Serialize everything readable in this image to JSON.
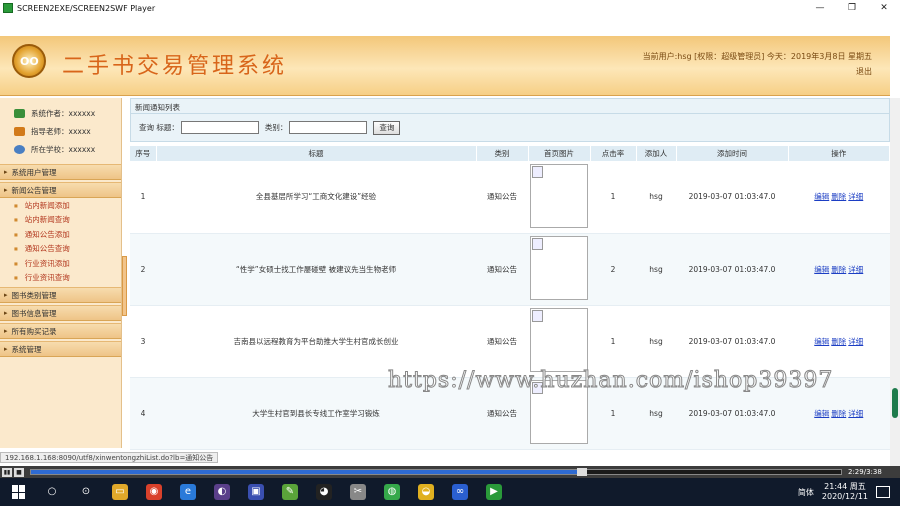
{
  "window": {
    "title": "SCREEN2EXE/SCREEN2SWF Player",
    "minimize": "—",
    "restore": "❐",
    "close": "✕"
  },
  "header": {
    "logo_text": "OO",
    "system_title": "二手书交易管理系统",
    "user_info": "当前用户:hsg [权限：超级管理员]  今天：2019年3月8日 星期五",
    "logout": "退出"
  },
  "sidebar": {
    "info": [
      {
        "label": "系统作者：xxxxxx",
        "icon": "people-icon",
        "color": "#3a8f3a"
      },
      {
        "label": "指导老师：xxxxx",
        "icon": "teacher-icon",
        "color": "#d27a1a"
      },
      {
        "label": "所在学校：xxxxxx",
        "icon": "school-icon",
        "color": "#4a7fc2"
      }
    ],
    "menu": {
      "user_mgmt": "系统用户管理",
      "news_mgmt": "新闻公告管理",
      "news_items": [
        "站内新闻添加",
        "站内新闻查询",
        "通知公告添加",
        "通知公告查询",
        "行业资讯添加",
        "行业资讯查询"
      ],
      "book_category": "图书类别管理",
      "book_info": "图书信息管理",
      "purchases": "所有购买记录",
      "system": "系统管理"
    }
  },
  "main": {
    "breadcrumb": "新闻通知列表",
    "search": {
      "prefix": "查询 标题：",
      "category": "类别：",
      "button": "查询",
      "title_value": "",
      "category_value": ""
    },
    "columns": [
      "序号",
      "标题",
      "类别",
      "首页图片",
      "点击率",
      "添加人",
      "添加时间",
      "操作"
    ],
    "rows": [
      {
        "no": "1",
        "title": "全县基层所学习“工商文化建设”经验",
        "category": "通知公告",
        "clicks": "1",
        "author": "hsg",
        "time": "2019-03-07 01:03:47.0"
      },
      {
        "no": "2",
        "title": "“性学”女硕士找工作屡碰壁 被建议先当生物老师",
        "category": "通知公告",
        "clicks": "2",
        "author": "hsg",
        "time": "2019-03-07 01:03:47.0"
      },
      {
        "no": "3",
        "title": "吉南县以远程教育为平台助推大学生村官成长创业",
        "category": "通知公告",
        "clicks": "1",
        "author": "hsg",
        "time": "2019-03-07 01:03:47.0"
      },
      {
        "no": "4",
        "title": "大学生村官到县长专线工作室学习锻炼",
        "category": "通知公告",
        "clicks": "1",
        "author": "hsg",
        "time": "2019-03-07 01:03:47.0"
      }
    ],
    "ops": {
      "edit": "编辑",
      "delete": "删除",
      "detail": "详细"
    }
  },
  "status_url": "192.168.1.168:8090/utf8/xinwentongzhiList.do?lb=通知公告",
  "watermark": "https://www.huzhan.com/ishop39397",
  "player": {
    "play": "▮▮",
    "stop": "■",
    "time": "2:29/3:38",
    "progress": 0.68
  },
  "taskbar": {
    "ime": "简体",
    "time": "21:44 周五",
    "date": "2020/12/11",
    "apps": [
      {
        "icon": "cortana-icon",
        "glyph": "○",
        "color": "#101a2b"
      },
      {
        "icon": "search-icon",
        "glyph": "⊙",
        "color": "#101a2b"
      },
      {
        "icon": "explorer-icon",
        "glyph": "▭",
        "color": "#e0a82a"
      },
      {
        "icon": "chrome-icon",
        "glyph": "◉",
        "color": "#d9412b"
      },
      {
        "icon": "edge-icon",
        "glyph": "e",
        "color": "#2a7ad9"
      },
      {
        "icon": "eclipse-icon",
        "glyph": "◐",
        "color": "#5a3f8a"
      },
      {
        "icon": "editor-icon",
        "glyph": "▣",
        "color": "#3a4fb0"
      },
      {
        "icon": "notepad-icon",
        "glyph": "✎",
        "color": "#5aa33a"
      },
      {
        "icon": "qq-icon",
        "glyph": "◕",
        "color": "#222"
      },
      {
        "icon": "tools-icon",
        "glyph": "✂",
        "color": "#888"
      },
      {
        "icon": "browser-icon",
        "glyph": "◍",
        "color": "#35a84a"
      },
      {
        "icon": "snail-icon",
        "glyph": "◒",
        "color": "#e0b020"
      },
      {
        "icon": "vs-icon",
        "glyph": "∞",
        "color": "#2a5fd0"
      },
      {
        "icon": "player-app-icon",
        "glyph": "▶",
        "color": "#2a9a3a"
      }
    ]
  }
}
